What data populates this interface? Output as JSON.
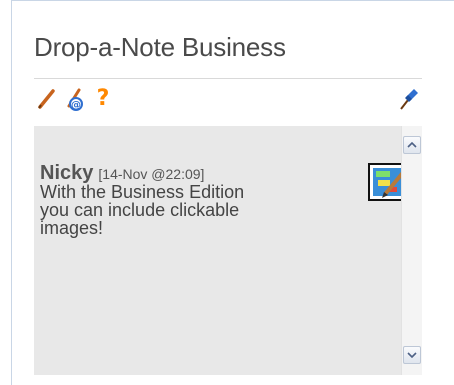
{
  "widget": {
    "title": "Drop-a-Note Business"
  },
  "toolbar": {
    "icons": [
      "pencil-icon",
      "add-note-icon",
      "help-icon",
      "pin-icon"
    ],
    "help_label": "?"
  },
  "note": {
    "author": "Nicky",
    "timestamp": "[14-Nov @22:09]",
    "text_lines": [
      "With the Business Edition",
      "you can include clickable",
      "images!"
    ],
    "image_icon": "clickable-image-icon"
  },
  "colors": {
    "title_text": "#4a4a4a",
    "notes_background": "#e8e8e8",
    "pencil": "#c8641e",
    "help": "#ff8800",
    "pin": "#2f6fd0"
  }
}
